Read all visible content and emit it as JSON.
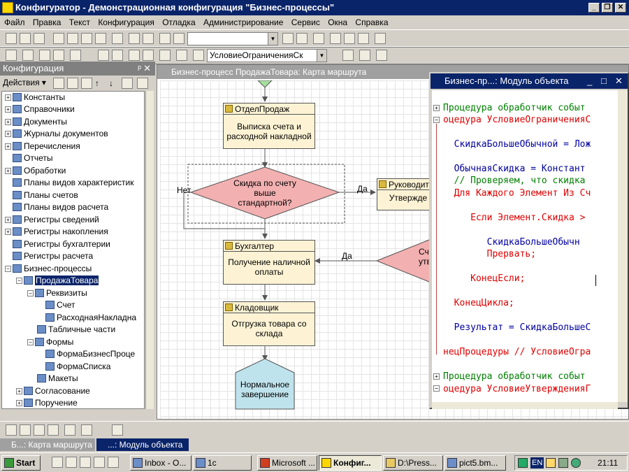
{
  "window": {
    "title": "Конфигуратор - Демонстрационная конфигурация \"Бизнес-процессы\""
  },
  "menu": [
    "Файл",
    "Правка",
    "Текст",
    "Конфигурация",
    "Отладка",
    "Администрирование",
    "Сервис",
    "Окна",
    "Справка"
  ],
  "toolbar": {
    "search_value": "",
    "procedure_combo": "УсловиеОграниченияСк"
  },
  "left_panel": {
    "title": "Конфигурация",
    "actions_label": "Действия",
    "tree": [
      {
        "label": "Константы"
      },
      {
        "label": "Справочники"
      },
      {
        "label": "Документы"
      },
      {
        "label": "Журналы документов"
      },
      {
        "label": "Перечисления"
      },
      {
        "label": "Отчеты"
      },
      {
        "label": "Обработки"
      },
      {
        "label": "Планы видов характеристик"
      },
      {
        "label": "Планы счетов"
      },
      {
        "label": "Планы видов расчета"
      },
      {
        "label": "Регистры сведений"
      },
      {
        "label": "Регистры накопления"
      },
      {
        "label": "Регистры бухгалтерии"
      },
      {
        "label": "Регистры расчета"
      },
      {
        "label": "Бизнес-процессы"
      },
      {
        "label": "ПродажаТовара"
      },
      {
        "label": "Реквизиты"
      },
      {
        "label": "Счет"
      },
      {
        "label": "РасходнаяНакладна"
      },
      {
        "label": "Табличные части"
      },
      {
        "label": "Формы"
      },
      {
        "label": "ФормаБизнесПроце"
      },
      {
        "label": "ФормаСписка"
      },
      {
        "label": "Макеты"
      },
      {
        "label": "Согласование"
      },
      {
        "label": "Поручение"
      }
    ]
  },
  "route_map": {
    "title": "Бизнес-процесс ПродажаТовара: Карта маршрута",
    "box1_role": "ОтделПродаж",
    "box1_text_1": "Выписка счета и",
    "box1_text_2": "расходной накладной",
    "cond1_1": "Скидка по счету",
    "cond1_2": "выше",
    "cond1_3": "стандартной?",
    "no_label": "Нет",
    "yes_label": "Да",
    "yes_label2": "Да",
    "box2_role": "Руководит",
    "box2_text": "Утвержде",
    "box3_role": "Бухгалтер",
    "box3_text_1": "Получение наличной",
    "box3_text_2": "оплаты",
    "cond2_1": "Сч",
    "cond2_2": "утвер",
    "box4_role": "Кладовщик",
    "box4_text_1": "Отгрузка товара со",
    "box4_text_2": "склада",
    "end_1": "Нормальное",
    "end_2": "завершение"
  },
  "module": {
    "title": "Бизнес-пр...: Модуль объекта",
    "lines": [
      "Процедура обработчик событ",
      "оцедура УсловиеОграниченияС",
      "",
      "  СкидкаБольшеОбычной = Лож",
      "",
      "  ОбычнаяСкидка = Констант",
      "  // Проверяем, что скидка",
      "  Для Каждого Элемент Из Сч",
      "",
      "     Если Элемент.Скидка >",
      "",
      "        СкидкаБольшеОбычн",
      "        Прервать;",
      "",
      "     КонецЕсли;",
      "",
      "  КонецЦикла;",
      "",
      "  Результат = СкидкаБольшеС",
      "",
      "нецПроцедуры // УсловиеОгра",
      "",
      "Процедура обработчик событ",
      "оцедура УсловиеУтвержденияГ"
    ]
  },
  "tabs": [
    "Б...: Карта маршрута",
    "...: Модуль объекта"
  ],
  "taskbar": {
    "start": "Start",
    "items": [
      "Inbox - O...",
      "1c",
      "Microsoft ...",
      "Конфиг...",
      "D:\\Press...",
      "pict5.bm..."
    ],
    "lang": "EN",
    "clock": "21:11"
  }
}
